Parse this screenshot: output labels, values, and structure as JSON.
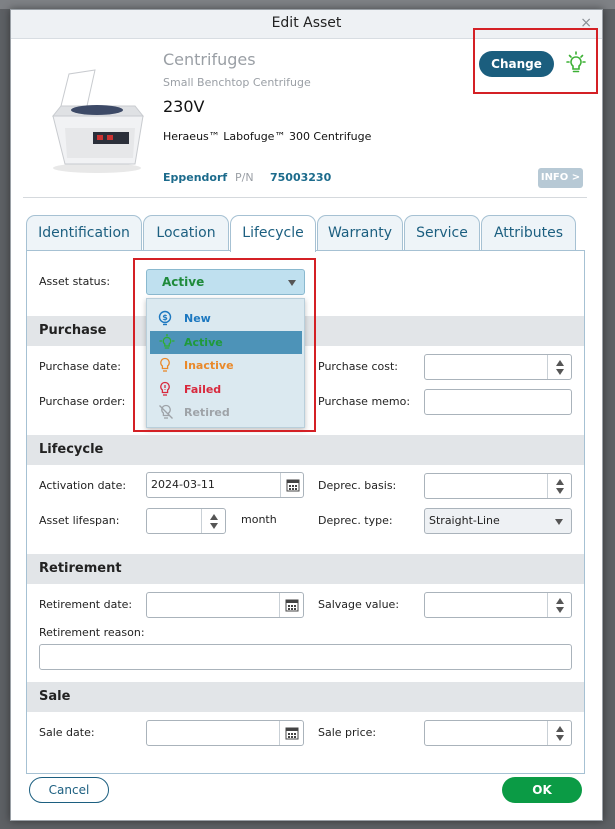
{
  "dialog": {
    "title": "Edit Asset",
    "close_label": "×"
  },
  "asset": {
    "category": "Centrifuges",
    "subcategory": "Small Benchtop Centrifuge",
    "voltage": "230V",
    "model": "Heraeus™ Labofuge™ 300 Centrifuge",
    "manufacturer": "Eppendorf",
    "pn_label": "P/N",
    "pn_value": "75003230",
    "info_label": "INFO >",
    "change_label": "Change"
  },
  "tabs": [
    {
      "label": "Identification"
    },
    {
      "label": "Location"
    },
    {
      "label": "Lifecycle",
      "active": true
    },
    {
      "label": "Warranty"
    },
    {
      "label": "Service"
    },
    {
      "label": "Attributes"
    }
  ],
  "status": {
    "label": "Asset status:",
    "selected": "Active",
    "options": [
      {
        "label": "New",
        "color": "#1c78c0",
        "icon": "money-icon"
      },
      {
        "label": "Active",
        "color": "#1f9a3b",
        "icon": "bulb-on-icon"
      },
      {
        "label": "Inactive",
        "color": "#e9892a",
        "icon": "bulb-off-icon"
      },
      {
        "label": "Failed",
        "color": "#d8293d",
        "icon": "bulb-alert-icon"
      },
      {
        "label": "Retired",
        "color": "#9ea3a8",
        "icon": "bulb-disabled-icon"
      }
    ]
  },
  "purchase": {
    "heading": "Purchase",
    "date_label": "Purchase date:",
    "order_label": "Purchase order:",
    "cost_label": "Purchase cost:",
    "memo_label": "Purchase memo:"
  },
  "lifecycle": {
    "heading": "Lifecycle",
    "activation_label": "Activation date:",
    "activation_value": "2024-03-11",
    "lifespan_label": "Asset lifespan:",
    "lifespan_unit": "month",
    "basis_label": "Deprec. basis:",
    "type_label": "Deprec. type:",
    "type_value": "Straight-Line"
  },
  "retirement": {
    "heading": "Retirement",
    "date_label": "Retirement date:",
    "salvage_label": "Salvage value:",
    "reason_label": "Retirement reason:"
  },
  "sale": {
    "heading": "Sale",
    "date_label": "Sale date:",
    "price_label": "Sale price:"
  },
  "footer": {
    "cancel_label": "Cancel",
    "ok_label": "OK"
  },
  "colors": {
    "accent": "#1b5e7e",
    "ok": "#0b9b45",
    "highlight": "#d42025"
  }
}
